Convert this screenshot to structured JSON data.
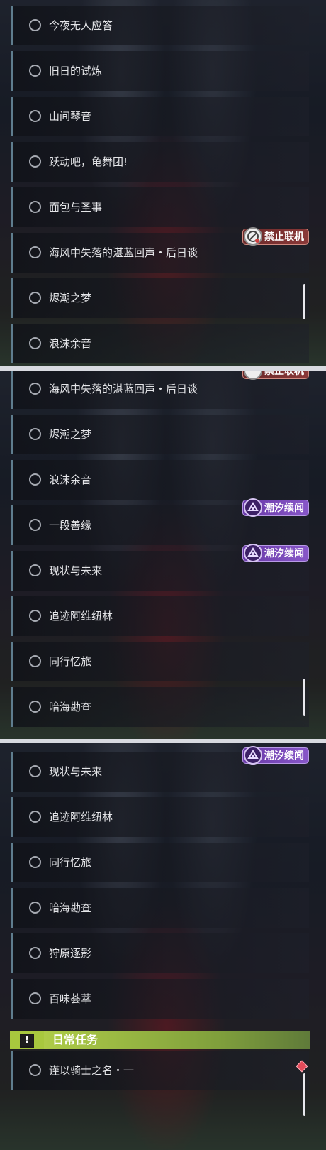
{
  "panel1": {
    "quests": [
      "今夜无人应答",
      "旧日的试炼",
      "山间琴音",
      "跃动吧，龟舞团!",
      "面包与圣事",
      "海风中失落的湛蓝回声・后日谈",
      "烬潮之梦",
      "浪沫余音"
    ],
    "badge": "禁止联机"
  },
  "panel2": {
    "quests": [
      "海风中失落的湛蓝回声・后日谈",
      "烬潮之梦",
      "浪沫余音",
      "一段善缘",
      "现状与未来",
      "追迹阿维纽林",
      "同行忆旅",
      "暗海勘查"
    ],
    "badge_top_cropped": "禁止联机",
    "badges": [
      "潮汐续闻",
      "潮汐续闻"
    ]
  },
  "panel3": {
    "quests": [
      "现状与未来",
      "追迹阿维纽林",
      "同行忆旅",
      "暗海勘查",
      "狩原逐影",
      "百味荟萃"
    ],
    "badge": "潮汐续闻",
    "daily_header": "日常任务",
    "daily_icon": "!",
    "daily_quests": [
      "谨以骑士之名・一"
    ]
  },
  "icons": {
    "quest_status": "circle-icon",
    "no_coop": "no-coop-icon",
    "tide": "tide-icon",
    "daily": "exclamation-icon",
    "new_marker": "diamond-icon"
  },
  "colors": {
    "row_accent": "#5f7d8e",
    "tide_badge": "#7a49b8",
    "no_coop_badge": "#7a3232",
    "daily_bar": "#b7d44a"
  }
}
